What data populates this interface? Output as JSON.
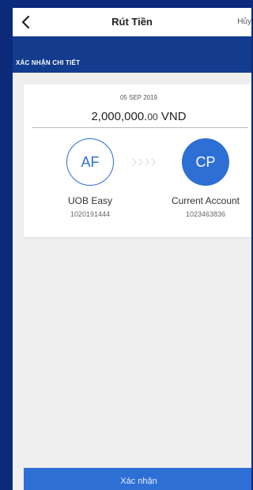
{
  "header": {
    "title": "Rút Tiền",
    "cancel_label": "Hủy"
  },
  "subheader": {
    "label": "XÁC NHẬN CHI TIẾT"
  },
  "transfer": {
    "date": "05 SEP 2019",
    "amount_main": "2,000,000.",
    "amount_cents": "00",
    "currency": "VND",
    "from": {
      "initials": "AF",
      "name": "UOB Easy",
      "number": "1020191444"
    },
    "to": {
      "initials": "CP",
      "name": "Current Account",
      "number": "1023463836"
    }
  },
  "actions": {
    "confirm_label": "Xác nhận"
  },
  "colors": {
    "frame": "#0b2a7a",
    "subheader": "#133b8e",
    "accent": "#2e6fd6",
    "background": "#efefef"
  },
  "icons": [
    "back-chevron-icon",
    "transfer-arrows-icon"
  ]
}
